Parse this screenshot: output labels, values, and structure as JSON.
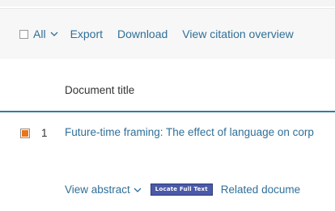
{
  "toolbar": {
    "select_all_label": "All",
    "export_label": "Export",
    "download_label": "Download",
    "citation_overview_label": "View citation overview"
  },
  "table": {
    "header_document_title": "Document title",
    "rows": [
      {
        "number": "1",
        "selected": true,
        "title": "Future-time framing: The effect of language on corp",
        "actions": {
          "view_abstract_label": "View abstract",
          "locate_full_text_label": "Locate Full Text",
          "related_documents_label": "Related docume"
        }
      }
    ]
  },
  "colors": {
    "link": "#2f6f98",
    "header_rule": "#2e7f9b",
    "checkbox_selected": "#e8751a",
    "locate_button": "#4a5aa8"
  },
  "icons": {
    "select_all_dropdown": "chevron-down-icon",
    "abstract_dropdown": "chevron-down-icon"
  }
}
